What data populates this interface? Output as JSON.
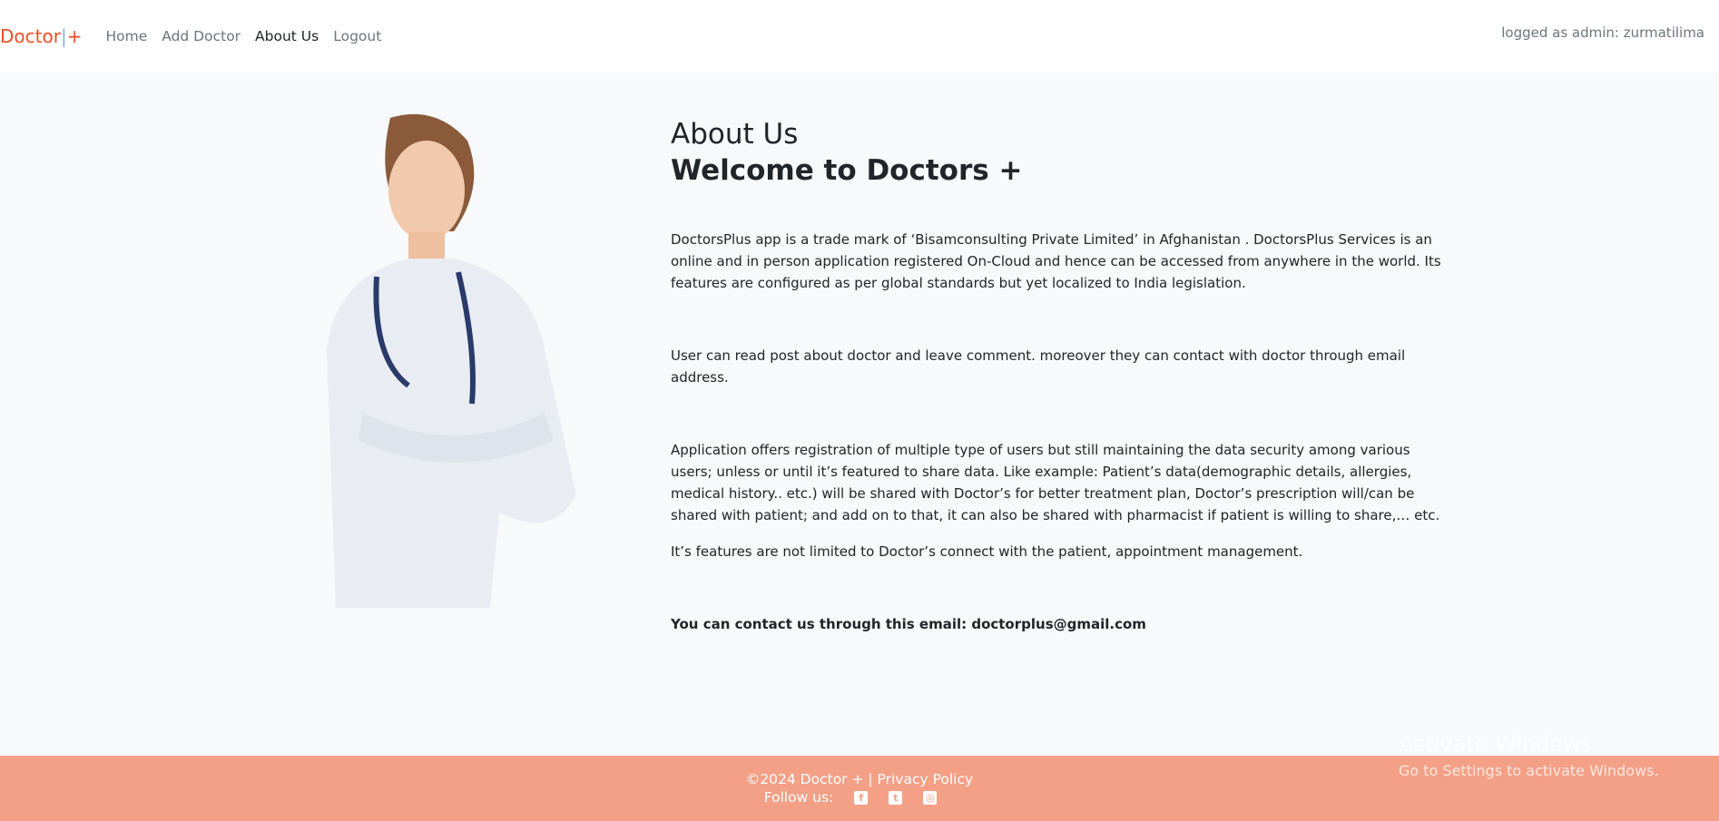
{
  "nav": {
    "brand": "Doctor",
    "brand_sep": "|",
    "brand_plus": "+",
    "items": [
      {
        "label": "Home"
      },
      {
        "label": "Add Doctor"
      },
      {
        "label": "About Us"
      },
      {
        "label": "Logout"
      }
    ],
    "logged": "logged as admin: zurmatilima"
  },
  "main": {
    "title": "About Us",
    "subtitle": "Welcome to Doctors +",
    "paragraphs": [
      "DoctorsPlus app is a trade mark of ‘Bisamconsulting Private Limited’ in Afghanistan . DoctorsPlus Services is an online and in person application registered On-Cloud and hence can be accessed from anywhere in the world. Its features are configured as per global standards but yet localized to India legislation.",
      "User can read post about doctor and leave comment. moreover they can contact with doctor through email address.",
      "Application offers registration of multiple type of users but still maintaining the data security among various users; unless or until it’s featured to share data. Like example: Patient’s data(demographic details, allergies, medical history.. etc.) will be shared with Doctor’s for better treatment plan, Doctor’s prescription will/can be shared with patient; and add on to that, it can also be shared with pharmacist if patient is willing to share,… etc.",
      "It’s features are not limited to Doctor’s connect with the patient, appointment management."
    ],
    "contact": "You can contact us through this email: doctorplus@gmail.com"
  },
  "footer": {
    "copyright": "©2024 Doctor + | Privacy Policy",
    "follow": "Follow us:",
    "icons": [
      "facebook-icon",
      "twitter-icon",
      "instagram-icon"
    ],
    "color": "#f4a086"
  },
  "watermark": {
    "title": "Activate Windows",
    "sub": "Go to Settings to activate Windows."
  }
}
